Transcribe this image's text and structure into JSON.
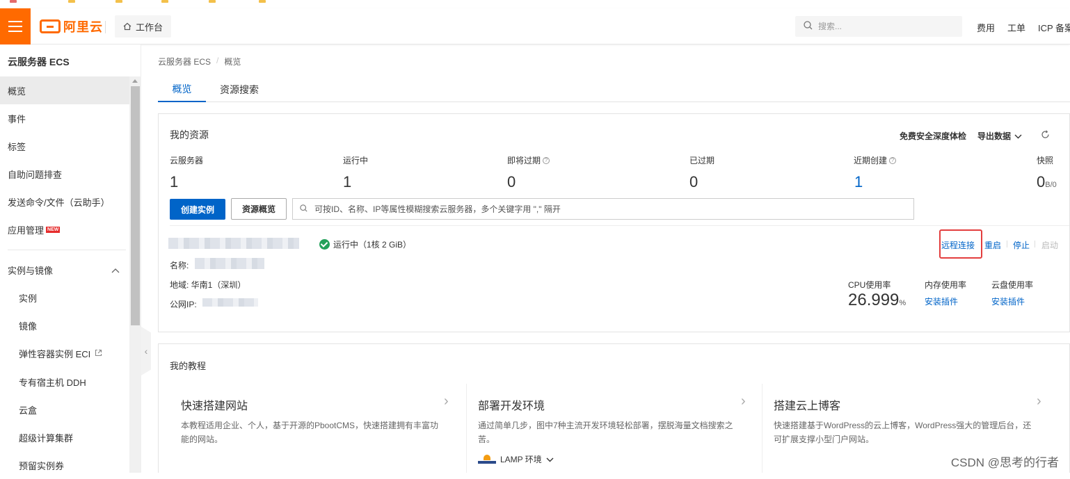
{
  "header": {
    "logo_text": "阿里云",
    "workbench_label": "工作台",
    "search_placeholder": "搜索...",
    "links": [
      "费用",
      "工单",
      "ICP 备案"
    ]
  },
  "sidebar": {
    "title": "云服务器 ECS",
    "items": [
      {
        "label": "概览",
        "active": true
      },
      {
        "label": "事件"
      },
      {
        "label": "标签"
      },
      {
        "label": "自助问题排查"
      },
      {
        "label": "发送命令/文件（云助手）"
      },
      {
        "label": "应用管理",
        "badge": "NEW"
      }
    ],
    "section": {
      "label": "实例与镜像",
      "expanded": true
    },
    "sub_items": [
      {
        "label": "实例"
      },
      {
        "label": "镜像"
      },
      {
        "label": "弹性容器实例 ECI"
      },
      {
        "label": "专有宿主机 DDH"
      },
      {
        "label": "云盒"
      },
      {
        "label": "超级计算集群"
      },
      {
        "label": "预留实例券"
      }
    ]
  },
  "breadcrumb": [
    "云服务器 ECS",
    "概览"
  ],
  "tabs": [
    {
      "label": "概览",
      "active": true
    },
    {
      "label": "资源搜索"
    }
  ],
  "resources": {
    "title": "我的资源",
    "free_check": "免费安全深度体检",
    "export": "导出数据",
    "stats": [
      {
        "label": "云服务器",
        "value": "1"
      },
      {
        "label": "运行中",
        "value": "1"
      },
      {
        "label": "即将过期",
        "value": "0",
        "help": true
      },
      {
        "label": "已过期",
        "value": "0"
      },
      {
        "label": "近期创建",
        "value": "1",
        "help": true
      },
      {
        "label": "快照",
        "value": "0",
        "unit": "B/0"
      }
    ],
    "create_button": "创建实例",
    "overview_button": "资源概览",
    "filter_placeholder": "可按ID、名称、IP等属性模糊搜索云服务器，多个关键字用 \",\" 隔开",
    "instance": {
      "status": "运行中（1核 2 GiB）",
      "name_label": "名称:",
      "region_label": "地域: 华南1（深圳）",
      "ip_label": "公网IP:",
      "actions": {
        "remote": "远程连接",
        "restart": "重启",
        "stop": "停止",
        "start": "启动"
      },
      "metrics": {
        "cpu_label": "CPU使用率",
        "cpu_value": "26.999",
        "cpu_unit": "%",
        "mem_label": "内存使用率",
        "mem_link": "安装插件",
        "disk_label": "云盘使用率",
        "disk_link": "安装插件"
      }
    }
  },
  "tutorials": {
    "title": "我的教程",
    "items": [
      {
        "title": "快速搭建网站",
        "desc1": "本教程适用企业、个人，基于开源的PbootCMS，快速搭建拥有丰富功",
        "desc2": "能的网站。"
      },
      {
        "title": "部署开发环境",
        "desc1": "通过简单几步，图中7种主流开发环境轻松部署，摆脱海量文档搜索之",
        "desc2": "苦。",
        "select": "LAMP 环境"
      },
      {
        "title": "搭建云上博客",
        "desc1": "快速搭建基于WordPress的云上博客，WordPress强大的管理后台，还",
        "desc2": "可扩展支撑小型门户网站。"
      }
    ]
  },
  "watermark": "CSDN @思考的行者",
  "colors": {
    "brand": "#ff6a00",
    "primary": "#0064c8",
    "success": "#23a15a",
    "highlight": "#e33e3e"
  }
}
